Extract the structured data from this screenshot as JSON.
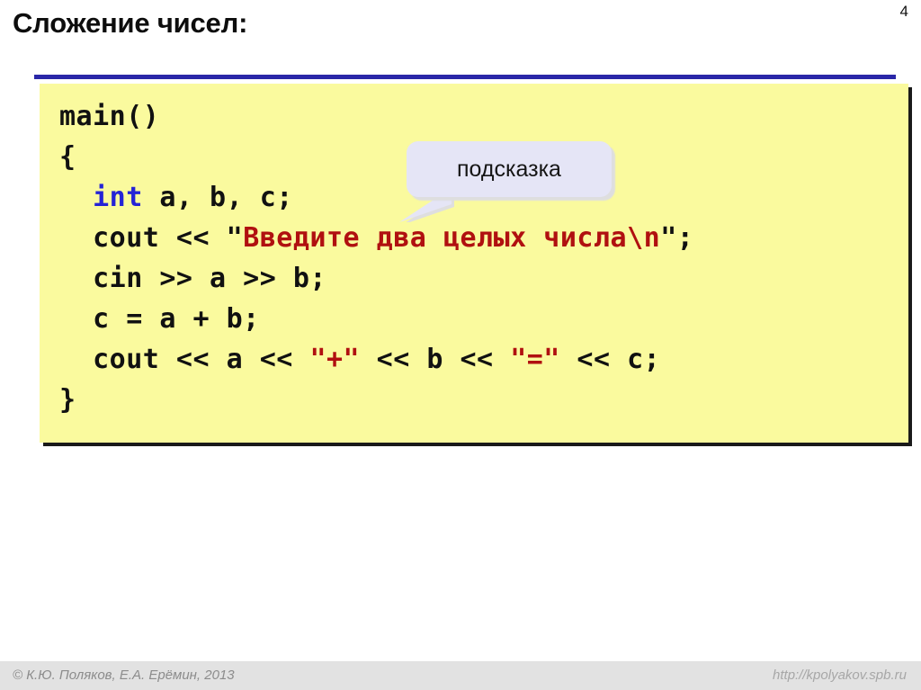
{
  "slide": {
    "page_number": "4",
    "title": "Сложение чисел:",
    "accent_rule_color": "#2a27a8",
    "code_panel_bg": "#fafa9e",
    "keyword_color": "#2423d6",
    "string_color": "#b01010"
  },
  "code": {
    "language": "cpp",
    "lines": [
      {
        "id": "line-1",
        "text": "main()",
        "tokens": [
          {
            "t": "main()",
            "k": "plain"
          }
        ]
      },
      {
        "id": "line-2",
        "text": "{",
        "tokens": [
          {
            "t": "{",
            "k": "plain"
          }
        ]
      },
      {
        "id": "line-3",
        "text": "  int a, b, c;",
        "tokens": [
          {
            "t": "  ",
            "k": "plain"
          },
          {
            "t": "int",
            "k": "keyword"
          },
          {
            "t": " a, b, c;",
            "k": "plain"
          }
        ]
      },
      {
        "id": "line-4",
        "text": "  cout << \"Введите два целых числа\\n\";",
        "tokens": [
          {
            "t": "  cout << \"",
            "k": "plain"
          },
          {
            "t": "Введите два целых числа\\n",
            "k": "string"
          },
          {
            "t": "\";",
            "k": "plain"
          }
        ]
      },
      {
        "id": "line-5",
        "text": "  cin >> a >> b;",
        "tokens": [
          {
            "t": "  cin >> a >> b;",
            "k": "plain"
          }
        ]
      },
      {
        "id": "line-6",
        "text": "  c = a + b;",
        "tokens": [
          {
            "t": "  c = a + b;",
            "k": "plain"
          }
        ]
      },
      {
        "id": "line-7",
        "text": "  cout << a << \"+\" << b << \"=\" << c;",
        "tokens": [
          {
            "t": "  cout << a << ",
            "k": "plain"
          },
          {
            "t": "\"+\"",
            "k": "string"
          },
          {
            "t": " << b << ",
            "k": "plain"
          },
          {
            "t": "\"=\"",
            "k": "string"
          },
          {
            "t": " << c;",
            "k": "plain"
          }
        ]
      },
      {
        "id": "line-8",
        "text": "}",
        "tokens": [
          {
            "t": "}",
            "k": "plain"
          }
        ]
      }
    ]
  },
  "callout": {
    "text": "подсказка",
    "bg": "#e5e5f6"
  },
  "footer": {
    "copyright": "© К.Ю. Поляков, Е.А. Ерёмин, 2013",
    "url": "http://kpolyakov.spb.ru"
  }
}
